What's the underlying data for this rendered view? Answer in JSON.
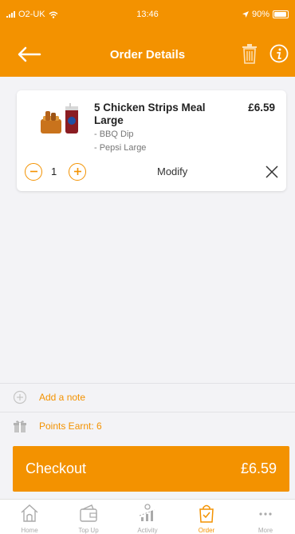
{
  "status_bar": {
    "carrier": "O2-UK",
    "time": "13:46",
    "battery": "90%"
  },
  "header": {
    "title": "Order Details",
    "icons": {
      "back": "arrow-left-icon",
      "trash": "trash-icon",
      "info": "info-icon"
    }
  },
  "order_item": {
    "name": "5 Chicken Strips Meal Large",
    "price": "£6.59",
    "modifiers": [
      "- BBQ Dip",
      "- Pepsi Large"
    ],
    "quantity": "1",
    "modify_label": "Modify"
  },
  "note": {
    "label": "Add a note"
  },
  "points": {
    "label": "Points Earnt: 6"
  },
  "checkout": {
    "label": "Checkout",
    "total": "£6.59"
  },
  "tabbar": {
    "tabs": [
      {
        "label": "Home",
        "icon": "home-icon"
      },
      {
        "label": "Top Up",
        "icon": "wallet-icon"
      },
      {
        "label": "Activity",
        "icon": "activity-icon"
      },
      {
        "label": "Order",
        "icon": "bag-icon"
      },
      {
        "label": "More",
        "icon": "more-icon"
      }
    ],
    "active": "Order"
  },
  "colors": {
    "brand": "#f39200",
    "background": "#f3f3f6"
  }
}
